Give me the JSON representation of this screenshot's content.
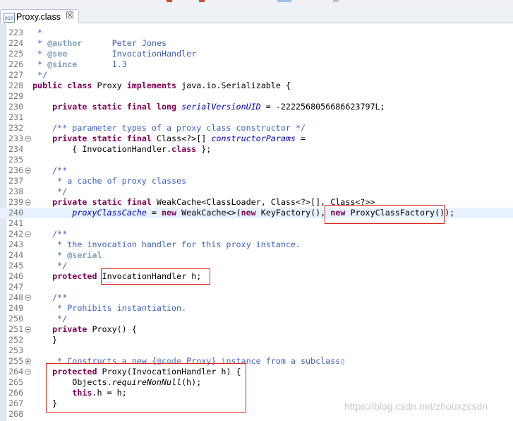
{
  "tab": {
    "title": "Proxy.class",
    "close_glyph": "☒",
    "icon": "class-file-icon",
    "icon_text": "010"
  },
  "watermark": "https://blog.csdn.net/zhouxzcsdn",
  "colors": {
    "keyword": "#7f0055",
    "comment": "#3f5fbf",
    "javadoc_tag": "#7f9fbf",
    "field": "#0000c0",
    "highlight_line": "#e8f2fe",
    "annotation_box": "#e0201a"
  },
  "lines": [
    {
      "n": "223",
      "fold": "",
      "hl": false,
      "seg": [
        {
          "t": " *",
          "c": "cm"
        }
      ]
    },
    {
      "n": "224",
      "fold": "",
      "hl": false,
      "seg": [
        {
          "t": " * ",
          "c": "cm"
        },
        {
          "t": "@author",
          "c": "tag"
        },
        {
          "t": "      Peter Jones",
          "c": "cm"
        }
      ]
    },
    {
      "n": "225",
      "fold": "",
      "hl": false,
      "seg": [
        {
          "t": " * ",
          "c": "cm"
        },
        {
          "t": "@see",
          "c": "tag"
        },
        {
          "t": "         InvocationHandler",
          "c": "cm"
        }
      ]
    },
    {
      "n": "226",
      "fold": "",
      "hl": false,
      "seg": [
        {
          "t": " * ",
          "c": "cm"
        },
        {
          "t": "@since",
          "c": "tag"
        },
        {
          "t": "       1.3",
          "c": "cm"
        }
      ]
    },
    {
      "n": "227",
      "fold": "",
      "hl": false,
      "seg": [
        {
          "t": " */",
          "c": "cm"
        }
      ]
    },
    {
      "n": "228",
      "fold": "",
      "hl": false,
      "seg": [
        {
          "t": "public class",
          "c": "kw"
        },
        {
          "t": " Proxy ",
          "c": ""
        },
        {
          "t": "implements",
          "c": "kw"
        },
        {
          "t": " java.io.Serializable {",
          "c": ""
        }
      ]
    },
    {
      "n": "229",
      "fold": "",
      "hl": false,
      "seg": []
    },
    {
      "n": "230",
      "fold": "",
      "hl": false,
      "seg": [
        {
          "t": "    ",
          "c": ""
        },
        {
          "t": "private static final long",
          "c": "kw"
        },
        {
          "t": " ",
          "c": ""
        },
        {
          "t": "serialVersionUID",
          "c": "fld"
        },
        {
          "t": " = -2222568056686623797L;",
          "c": ""
        }
      ]
    },
    {
      "n": "231",
      "fold": "",
      "hl": false,
      "seg": []
    },
    {
      "n": "232",
      "fold": "",
      "hl": false,
      "seg": [
        {
          "t": "    /** parameter types of a proxy class constructor */",
          "c": "cm"
        }
      ]
    },
    {
      "n": "233",
      "fold": "minus",
      "hl": false,
      "seg": [
        {
          "t": "    ",
          "c": ""
        },
        {
          "t": "private static final",
          "c": "kw"
        },
        {
          "t": " Class<?>[] ",
          "c": ""
        },
        {
          "t": "constructorParams",
          "c": "fld"
        },
        {
          "t": " =",
          "c": ""
        }
      ]
    },
    {
      "n": "234",
      "fold": "",
      "hl": false,
      "seg": [
        {
          "t": "        { InvocationHandler.",
          "c": ""
        },
        {
          "t": "class",
          "c": "kw"
        },
        {
          "t": " };",
          "c": ""
        }
      ]
    },
    {
      "n": "235",
      "fold": "",
      "hl": false,
      "seg": []
    },
    {
      "n": "236",
      "fold": "minus",
      "hl": false,
      "seg": [
        {
          "t": "    /**",
          "c": "cm"
        }
      ]
    },
    {
      "n": "237",
      "fold": "",
      "hl": false,
      "seg": [
        {
          "t": "     * a cache of proxy classes",
          "c": "cm"
        }
      ]
    },
    {
      "n": "238",
      "fold": "",
      "hl": false,
      "seg": [
        {
          "t": "     */",
          "c": "cm"
        }
      ]
    },
    {
      "n": "239",
      "fold": "minus",
      "hl": false,
      "seg": [
        {
          "t": "    ",
          "c": ""
        },
        {
          "t": "private static final",
          "c": "kw"
        },
        {
          "t": " WeakCache<ClassLoader, Class<?>[], Class<?>>",
          "c": ""
        }
      ]
    },
    {
      "n": "240",
      "fold": "",
      "hl": true,
      "seg": [
        {
          "t": "        ",
          "c": ""
        },
        {
          "t": "proxyClassCache",
          "c": "fld"
        },
        {
          "t": " = ",
          "c": ""
        },
        {
          "t": "new",
          "c": "kw"
        },
        {
          "t": " WeakCache<>(",
          "c": ""
        },
        {
          "t": "new",
          "c": "kw"
        },
        {
          "t": " KeyFactory(), ",
          "c": ""
        },
        {
          "t": "new",
          "c": "kw"
        },
        {
          "t": " ProxyClassFactory());",
          "c": ""
        }
      ]
    },
    {
      "n": "241",
      "fold": "",
      "hl": false,
      "seg": []
    },
    {
      "n": "242",
      "fold": "minus",
      "hl": false,
      "seg": [
        {
          "t": "    /**",
          "c": "cm"
        }
      ]
    },
    {
      "n": "243",
      "fold": "",
      "hl": false,
      "seg": [
        {
          "t": "     * the invocation handler for this proxy instance.",
          "c": "cm"
        }
      ]
    },
    {
      "n": "244",
      "fold": "",
      "hl": false,
      "seg": [
        {
          "t": "     * ",
          "c": "cm"
        },
        {
          "t": "@serial",
          "c": "tag"
        }
      ]
    },
    {
      "n": "245",
      "fold": "",
      "hl": false,
      "seg": [
        {
          "t": "     */",
          "c": "cm"
        }
      ]
    },
    {
      "n": "246",
      "fold": "",
      "hl": false,
      "seg": [
        {
          "t": "    ",
          "c": ""
        },
        {
          "t": "protected",
          "c": "kw"
        },
        {
          "t": " InvocationHandler h;",
          "c": ""
        }
      ]
    },
    {
      "n": "247",
      "fold": "",
      "hl": false,
      "seg": []
    },
    {
      "n": "248",
      "fold": "minus",
      "hl": false,
      "seg": [
        {
          "t": "    /**",
          "c": "cm"
        }
      ]
    },
    {
      "n": "249",
      "fold": "",
      "hl": false,
      "seg": [
        {
          "t": "     * Prohibits instantiation.",
          "c": "cm"
        }
      ]
    },
    {
      "n": "250",
      "fold": "",
      "hl": false,
      "seg": [
        {
          "t": "     */",
          "c": "cm"
        }
      ]
    },
    {
      "n": "251",
      "fold": "minus",
      "hl": false,
      "seg": [
        {
          "t": "    ",
          "c": ""
        },
        {
          "t": "private",
          "c": "kw"
        },
        {
          "t": " Proxy() {",
          "c": ""
        }
      ]
    },
    {
      "n": "252",
      "fold": "",
      "hl": false,
      "seg": [
        {
          "t": "    }",
          "c": ""
        }
      ]
    },
    {
      "n": "253",
      "fold": "",
      "hl": false,
      "seg": []
    },
    {
      "n": "255",
      "fold": "plus",
      "hl": false,
      "seg": [
        {
          "t": "     * Constructs a new {",
          "c": "cm"
        },
        {
          "t": "@code",
          "c": "tag"
        },
        {
          "t": " Proxy} instance from a subclass▯",
          "c": "cm"
        }
      ]
    },
    {
      "n": "264",
      "fold": "minus",
      "hl": false,
      "seg": [
        {
          "t": "    ",
          "c": ""
        },
        {
          "t": "protected",
          "c": "kw"
        },
        {
          "t": " Proxy(InvocationHandler h) {",
          "c": ""
        }
      ]
    },
    {
      "n": "265",
      "fold": "",
      "hl": false,
      "seg": [
        {
          "t": "        Objects.",
          "c": ""
        },
        {
          "t": "requireNonNull",
          "c": "ital"
        },
        {
          "t": "(h);",
          "c": ""
        }
      ]
    },
    {
      "n": "266",
      "fold": "",
      "hl": false,
      "seg": [
        {
          "t": "        ",
          "c": ""
        },
        {
          "t": "this",
          "c": "kw"
        },
        {
          "t": ".h = h;",
          "c": ""
        }
      ]
    },
    {
      "n": "267",
      "fold": "",
      "hl": false,
      "seg": [
        {
          "t": "    }",
          "c": ""
        }
      ]
    },
    {
      "n": "268",
      "fold": "",
      "hl": false,
      "seg": []
    }
  ]
}
